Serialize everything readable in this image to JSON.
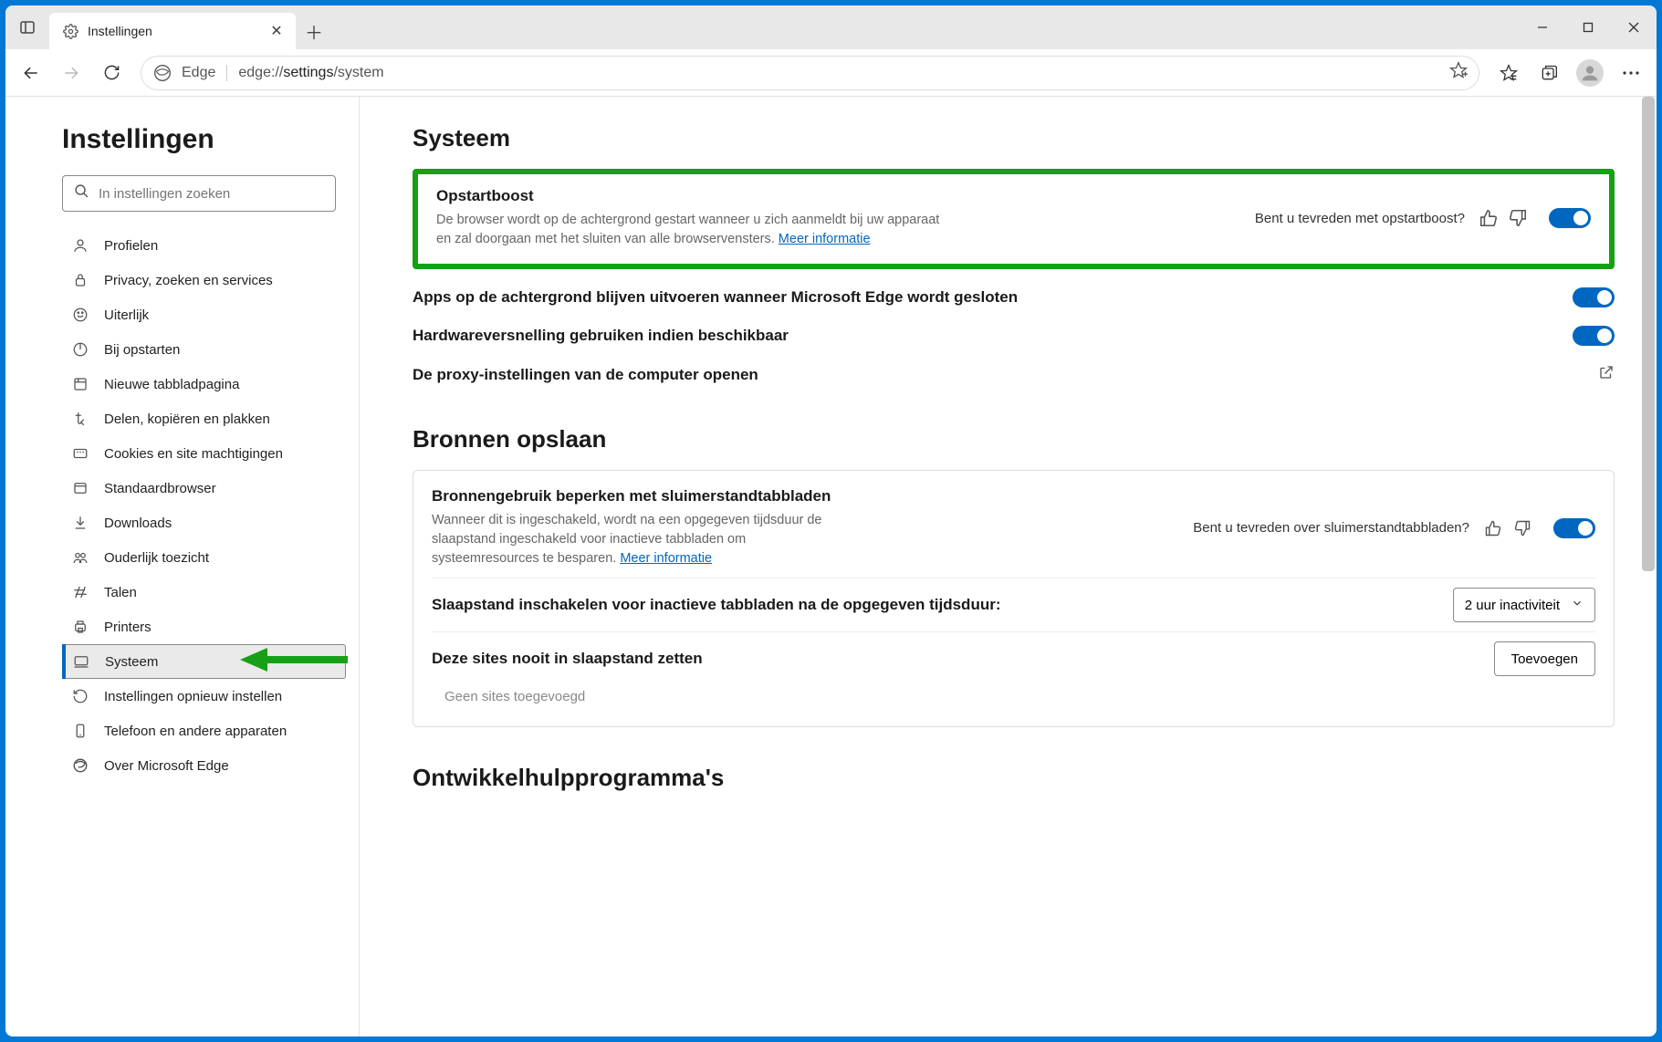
{
  "titlebar": {
    "tab_label": "Instellingen"
  },
  "toolbar": {
    "edge_label": "Edge",
    "url_prefix": "edge://",
    "url_bold": "settings",
    "url_suffix": "/system"
  },
  "sidebar": {
    "heading": "Instellingen",
    "search_placeholder": "In instellingen zoeken",
    "items": [
      {
        "label": "Profielen"
      },
      {
        "label": "Privacy, zoeken en services"
      },
      {
        "label": "Uiterlijk"
      },
      {
        "label": "Bij opstarten"
      },
      {
        "label": "Nieuwe tabbladpagina"
      },
      {
        "label": "Delen, kopiëren en plakken"
      },
      {
        "label": "Cookies en site machtigingen"
      },
      {
        "label": "Standaardbrowser"
      },
      {
        "label": "Downloads"
      },
      {
        "label": "Ouderlijk toezicht"
      },
      {
        "label": "Talen"
      },
      {
        "label": "Printers"
      },
      {
        "label": "Systeem"
      },
      {
        "label": "Instellingen opnieuw instellen"
      },
      {
        "label": "Telefoon en andere apparaten"
      },
      {
        "label": "Over Microsoft Edge"
      }
    ],
    "selected_index": 12
  },
  "main": {
    "section1_title": "Systeem",
    "startup": {
      "title": "Opstartboost",
      "desc": "De browser wordt op de achtergrond gestart wanneer u zich aanmeldt bij uw apparaat en zal doorgaan met het sluiten van alle browservensters. ",
      "link": "Meer informatie",
      "feedback": "Bent u tevreden met opstartboost?"
    },
    "bg_apps": "Apps op de achtergrond blijven uitvoeren wanneer Microsoft Edge wordt gesloten",
    "hw_accel": "Hardwareversnelling gebruiken indien beschikbaar",
    "proxy": "De proxy-instellingen van de computer openen",
    "section2_title": "Bronnen opslaan",
    "sleep": {
      "title": "Bronnengebruik beperken met sluimerstandtabbladen",
      "desc": "Wanneer dit is ingeschakeld, wordt na een opgegeven tijdsduur de slaapstand ingeschakeld voor inactieve tabbladen om systeemresources te besparen. ",
      "link": "Meer informatie",
      "feedback": "Bent u tevreden over sluimerstandtabbladen?"
    },
    "sleep_after_label": "Slaapstand inschakelen voor inactieve tabbladen na de opgegeven tijdsduur:",
    "sleep_after_value": "2 uur inactiviteit",
    "never_sleep_label": "Deze sites nooit in slaapstand zetten",
    "add_button": "Toevoegen",
    "none_added": "Geen sites toegevoegd",
    "section3_title": "Ontwikkelhulpprogramma's"
  }
}
